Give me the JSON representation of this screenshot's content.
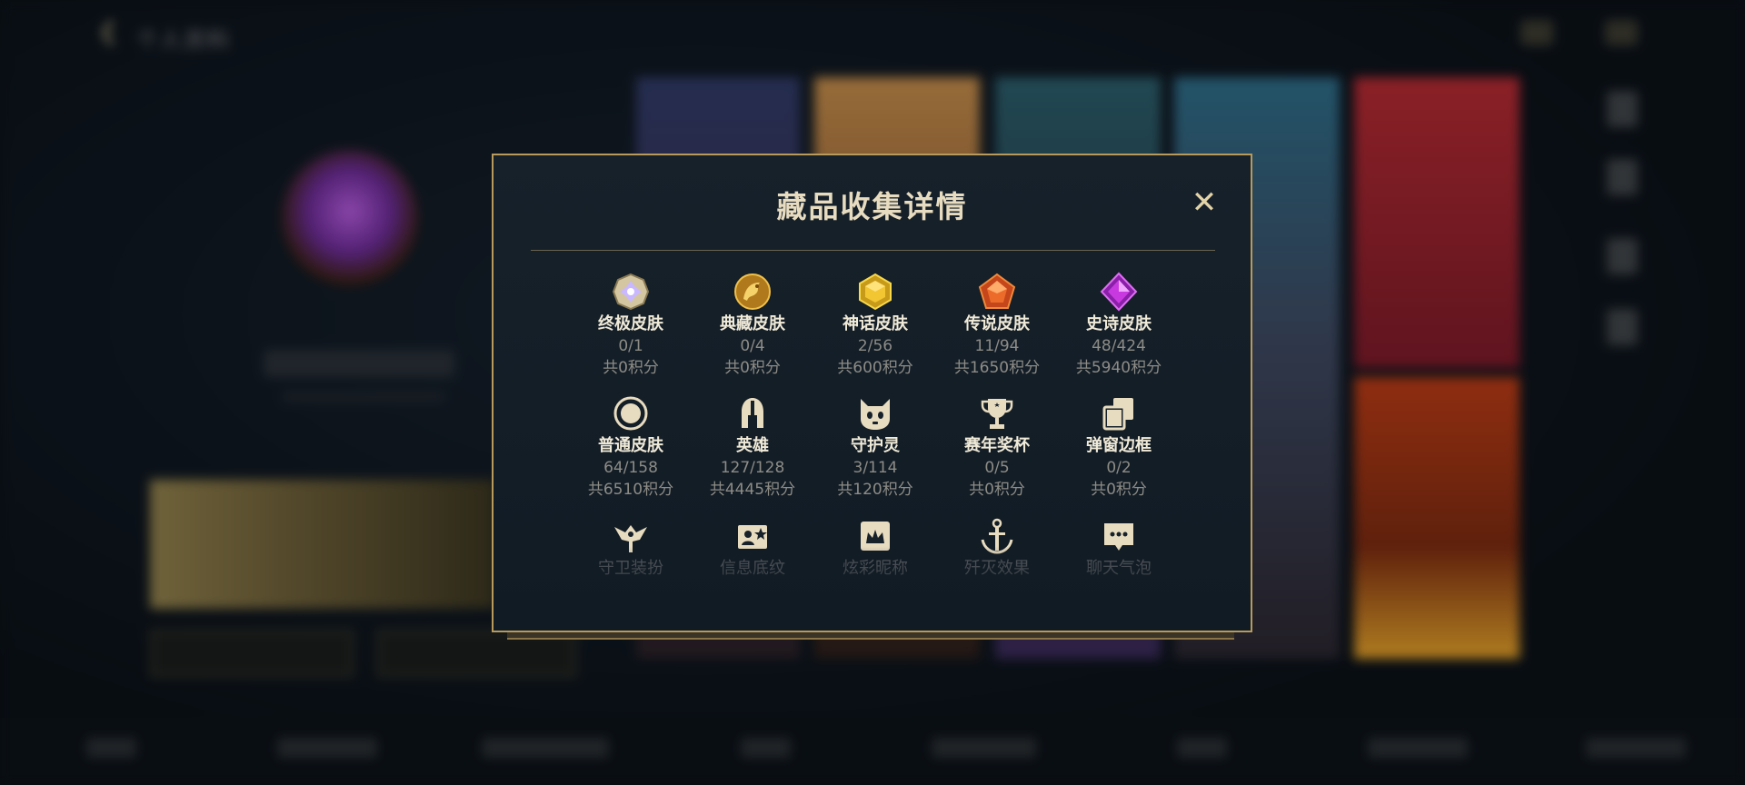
{
  "background": {
    "title": "个人资料",
    "nav_items": [
      "",
      "",
      "",
      "",
      "",
      "",
      "",
      "",
      ""
    ]
  },
  "dialog": {
    "title": "藏品收集详情",
    "close_label": "✕",
    "items": [
      {
        "label": "终极皮肤",
        "count": "0/1",
        "points": "共0积分",
        "icon": "ultimate-skin-icon",
        "color": "#c7b8ff"
      },
      {
        "label": "典藏皮肤",
        "count": "0/4",
        "points": "共0积分",
        "icon": "prestige-skin-icon",
        "color": "#e3a92f"
      },
      {
        "label": "神话皮肤",
        "count": "2/56",
        "points": "共600积分",
        "icon": "mythic-skin-icon",
        "color": "#f2c533"
      },
      {
        "label": "传说皮肤",
        "count": "11/94",
        "points": "共1650积分",
        "icon": "legendary-skin-icon",
        "color": "#ec6a2a"
      },
      {
        "label": "史诗皮肤",
        "count": "48/424",
        "points": "共5940积分",
        "icon": "epic-skin-icon",
        "color": "#c83ae0"
      },
      {
        "label": "普通皮肤",
        "count": "64/158",
        "points": "共6510积分",
        "icon": "common-skin-icon",
        "color": "#e8dcc0"
      },
      {
        "label": "英雄",
        "count": "127/128",
        "points": "共4445积分",
        "icon": "champion-helmet-icon",
        "color": "#e8dcc0"
      },
      {
        "label": "守护灵",
        "count": "3/114",
        "points": "共120积分",
        "icon": "guardian-spirit-icon",
        "color": "#e8dcc0"
      },
      {
        "label": "赛年奖杯",
        "count": "0/5",
        "points": "共0积分",
        "icon": "season-trophy-icon",
        "color": "#e8dcc0"
      },
      {
        "label": "弹窗边框",
        "count": "0/2",
        "points": "共0积分",
        "icon": "popup-frame-icon",
        "color": "#e8dcc0"
      },
      {
        "label": "守卫装扮",
        "icon": "ward-skin-icon",
        "color": "#e8dcc0"
      },
      {
        "label": "信息底纹",
        "icon": "profile-banner-icon",
        "color": "#e8dcc0"
      },
      {
        "label": "炫彩昵称",
        "icon": "colorful-nickname-icon",
        "color": "#e8dcc0"
      },
      {
        "label": "歼灭效果",
        "icon": "elimination-effect-icon",
        "color": "#e8dcc0"
      },
      {
        "label": "聊天气泡",
        "icon": "chat-bubble-icon",
        "color": "#e8dcc0"
      }
    ]
  },
  "colors": {
    "gold_border": "#b89a5c",
    "panel_bg": "#141e27",
    "title_text": "#e8dcc0",
    "muted_text": "#8d8c86"
  }
}
